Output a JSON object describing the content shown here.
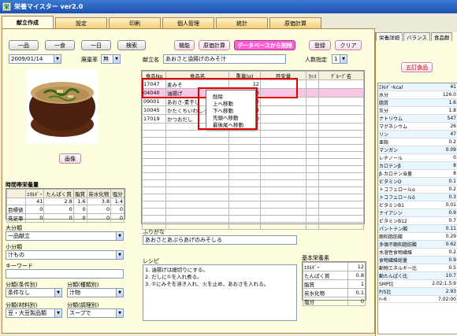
{
  "window": {
    "title": "栄養マイスター ver2.0",
    "icon": "app-icon"
  },
  "tabs": [
    {
      "label": "献立作成",
      "active": true
    },
    {
      "label": "設定"
    },
    {
      "label": "印刷"
    },
    {
      "label": "個人管理"
    },
    {
      "label": "統計"
    },
    {
      "label": "原価計算"
    }
  ],
  "toolbar": {
    "ippin": "一品",
    "ishoku": "一食",
    "ichinichi": "一日",
    "search": "検索",
    "kinou": "機能",
    "genka": "原価計算",
    "delete_db": "データベースから削除",
    "register": "登録",
    "clear": "クリア"
  },
  "date": {
    "value": "2009/01/14"
  },
  "haiki": {
    "label": "廃棄率",
    "value": "無"
  },
  "menu": {
    "label": "献立名",
    "value": "あおさと油揚げのみそ汁"
  },
  "people": {
    "label": "人数指定",
    "value": "1"
  },
  "food_table": {
    "headers": [
      "食品No",
      "食品名",
      "重量(g)",
      "目安量",
      "ｶｯｺ",
      "ｸﾞﾙｰﾌﾟ名"
    ],
    "rows": [
      [
        "17047",
        "麦みそ",
        "12",
        "",
        "",
        ""
      ],
      [
        "04040",
        "油揚げ",
        "3",
        "",
        "",
        ""
      ],
      [
        "09001",
        "あおさ-素干し",
        "0.3",
        "",
        "",
        ""
      ],
      [
        "10045",
        "かたくちいわし-煮干し",
        "0.4",
        "",
        "",
        ""
      ],
      [
        "17019",
        "かつおだし",
        "120",
        "",
        "",
        ""
      ]
    ]
  },
  "context_menu": [
    "削除",
    "上へ移動",
    "下へ移動",
    "先頭へ移動",
    "最後尾へ移動"
  ],
  "image_button": "画像",
  "jikan": {
    "title": "時間帯栄養量",
    "headers": [
      "",
      "ｴﾈﾙｷﾞｰ",
      "たんぱく質",
      "脂質",
      "炭水化物",
      "塩分"
    ],
    "rows": [
      [
        "",
        "41",
        "2.8",
        "1.6",
        "3.8",
        "1.4"
      ],
      [
        "目標値",
        "0",
        "0",
        "0",
        "0",
        "0"
      ],
      [
        "充足率",
        "0",
        "0",
        "0",
        "0",
        "0"
      ]
    ]
  },
  "daibunrui": {
    "label": "大分類",
    "value": "一品献立"
  },
  "shobunrui": {
    "label": "小分類",
    "value": "汁もの"
  },
  "keyword": {
    "label": "キーワード",
    "value": ""
  },
  "bunrui_yoken": {
    "label": "分類(条件別)",
    "value": "条件なし"
  },
  "bunrui_shurui": {
    "label": "分類(種類別)",
    "value": "汁物"
  },
  "bunrui_zairyo": {
    "label": "分類(材料別)",
    "value": "豆・大豆製品類"
  },
  "bunrui_chori": {
    "label": "分類(調理別)",
    "value": "スープで"
  },
  "furigana": {
    "label": "ふりがな",
    "value": "あおさとあぶらあげのみそしる"
  },
  "recipe": {
    "label": "レシピ",
    "lines": [
      "1. 油揚げは細切りにする。",
      "2. だしに①を入れ煮る。",
      "3. ②にみそを溶き入れ、火を止め、あおさを入れる。"
    ]
  },
  "kihon": {
    "title": "基本栄養素",
    "rows": [
      [
        "ｴﾈﾙｷﾞｰ",
        "12"
      ],
      [
        "たんぱく質",
        "0.8"
      ],
      [
        "脂質",
        "1"
      ],
      [
        "炭水化物",
        "0.1"
      ],
      [
        "塩分",
        "0"
      ]
    ]
  },
  "right_tabs": [
    "栄養詳細",
    "バランス",
    "食品群"
  ],
  "gomoku_button": "五訂食品",
  "nutrients": [
    [
      "ｴﾈﾙｷﾞｰkcal",
      "41"
    ],
    [
      "水分",
      "126.0"
    ],
    [
      "脂質",
      "1.6"
    ],
    [
      "灰分",
      "1.8"
    ],
    [
      "ナトリウム",
      "547"
    ],
    [
      "マグネシウム",
      "26"
    ],
    [
      "リン",
      "47"
    ],
    [
      "亜鉛",
      "0.2"
    ],
    [
      "マンガン",
      "0.09"
    ],
    [
      "レチノール",
      "0"
    ],
    [
      "カロテンβ",
      "8"
    ],
    [
      "β-カロテン当量",
      "8"
    ],
    [
      "ビタミンD",
      "0.1"
    ],
    [
      "トコフェロールα",
      "0.2"
    ],
    [
      "トコフェロールδ",
      "0.3"
    ],
    [
      "ビタミンB1",
      "0.01"
    ],
    [
      "ナイアシン",
      "0.9"
    ],
    [
      "ビタミンB12",
      "0.7"
    ],
    [
      "パントテン酸",
      "0.11"
    ],
    [
      "飽和脂肪酸",
      "0.29"
    ],
    [
      "多価不飽和脂肪酸",
      "0.62"
    ],
    [
      "水溶性食物繊維",
      "0.2"
    ],
    [
      "食物繊維総量",
      "0.9"
    ],
    [
      "動物エネルギー比",
      "0.5"
    ],
    [
      "動たんぱく比",
      "10.7"
    ],
    [
      "SMP比",
      "2.02:1.5:9"
    ],
    [
      "P/S比",
      "2.93"
    ],
    [
      "n-6",
      "7.02:00"
    ]
  ],
  "colors": {
    "tab": "#f2cf7a",
    "panel": "#fffde0",
    "accent": "#ff5fd0",
    "highlight": "#e00000"
  }
}
